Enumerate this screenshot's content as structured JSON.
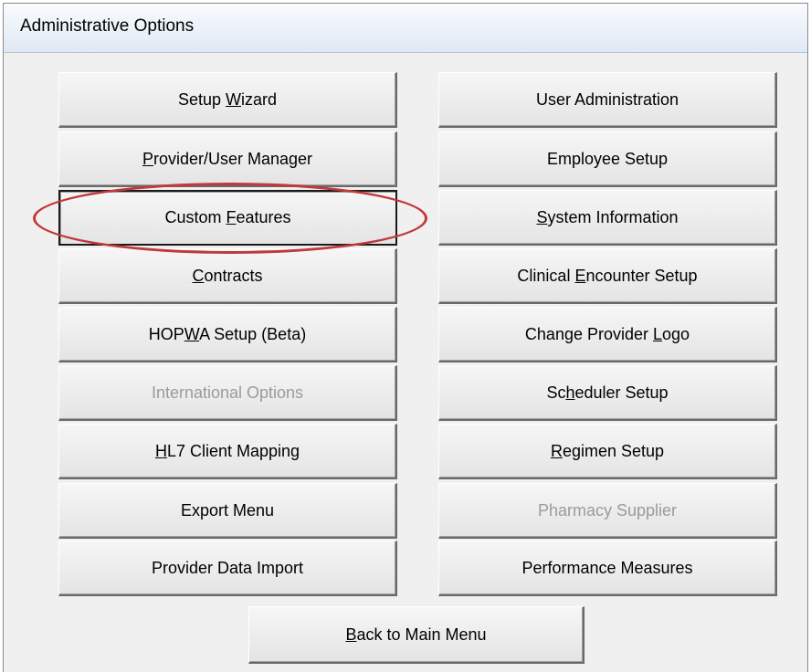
{
  "window": {
    "title": "Administrative Options"
  },
  "buttons_left": [
    {
      "id": "setup-wizard",
      "pre": "Setup ",
      "ul": "W",
      "post": "izard",
      "disabled": false
    },
    {
      "id": "provider-user-manager",
      "pre": "",
      "ul": "P",
      "post": "rovider/User Manager",
      "disabled": false
    },
    {
      "id": "custom-features",
      "pre": "Custom ",
      "ul": "F",
      "post": "eatures",
      "disabled": false,
      "selected": true
    },
    {
      "id": "contracts",
      "pre": "",
      "ul": "C",
      "post": "ontracts",
      "disabled": false
    },
    {
      "id": "hopwa-setup",
      "pre": "HOP",
      "ul": "W",
      "post": "A Setup (Beta)",
      "disabled": false
    },
    {
      "id": "international-options",
      "pre": "International Options",
      "ul": "",
      "post": "",
      "disabled": true
    },
    {
      "id": "hl7-client-mapping",
      "pre": "",
      "ul": "H",
      "post": "L7 Client Mapping",
      "disabled": false
    },
    {
      "id": "export-menu",
      "pre": "Export Menu",
      "ul": "",
      "post": "",
      "disabled": false
    },
    {
      "id": "provider-data-import",
      "pre": "Provider Data Import",
      "ul": "",
      "post": "",
      "disabled": false
    }
  ],
  "buttons_right": [
    {
      "id": "user-administration",
      "pre": "User Administration",
      "ul": "",
      "post": "",
      "disabled": false
    },
    {
      "id": "employee-setup",
      "pre": "Employee Setup",
      "ul": "",
      "post": "",
      "disabled": false
    },
    {
      "id": "system-information",
      "pre": "",
      "ul": "S",
      "post": "ystem Information",
      "disabled": false
    },
    {
      "id": "clinical-encounter-setup",
      "pre": "Clinical ",
      "ul": "E",
      "post": "ncounter Setup",
      "disabled": false
    },
    {
      "id": "change-provider-logo",
      "pre": "Change Provider ",
      "ul": "L",
      "post": "ogo",
      "disabled": false
    },
    {
      "id": "scheduler-setup",
      "pre": "Sc",
      "ul": "h",
      "post": "eduler Setup",
      "disabled": false
    },
    {
      "id": "regimen-setup",
      "pre": "",
      "ul": "R",
      "post": "egimen Setup",
      "disabled": false
    },
    {
      "id": "pharmacy-supplier",
      "pre": "Pharmacy Supplier",
      "ul": "",
      "post": "",
      "disabled": true
    },
    {
      "id": "performance-measures",
      "pre": "Performance Measures",
      "ul": "",
      "post": "",
      "disabled": false
    }
  ],
  "back_button": {
    "pre": "",
    "ul": "B",
    "post": "ack to Main Menu"
  },
  "colors": {
    "highlight": "#c0393b",
    "disabled_text": "#9b9b9b"
  }
}
